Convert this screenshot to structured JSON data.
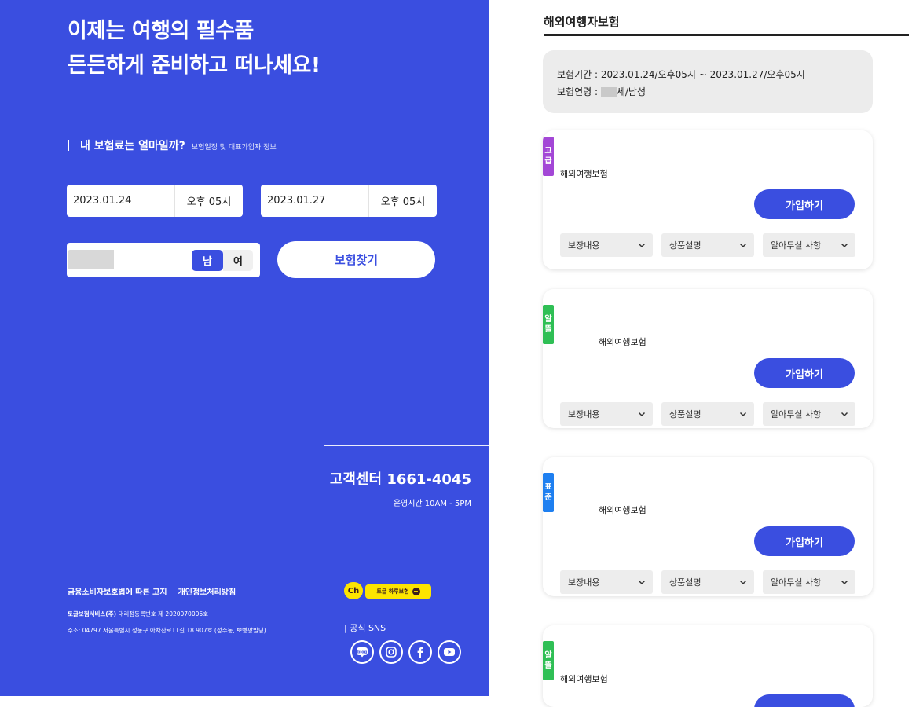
{
  "hero": {
    "line1": "이제는 여행의 필수품",
    "line2": "든든하게 준비하고 떠나세요!"
  },
  "query": {
    "title": "내 보험료는 얼마일까?",
    "subtitle": "보험일정 및 대표가입자 정보"
  },
  "dates": {
    "start_date": "2023.01.24",
    "start_time": "오후 05시",
    "end_date": "2023.01.27",
    "end_time": "오후 05시"
  },
  "gender": {
    "male": "남",
    "female": "여",
    "selected": "남"
  },
  "search_button": "보험찾기",
  "customer_center": {
    "title": "고객센터 1661-4045",
    "hours": "운영시간 10AM - 5PM"
  },
  "footer": {
    "link_1": "금융소비자보호법에 따른 고지",
    "link_2": "개인정보처리방침",
    "company_name": "토글보험서비스(주)",
    "company_reg": "대리점등록번호 제 2020070006호",
    "address": "주소: 04797 서울특별시 성동구 아차산로11길 18 907호 (성수동, 뽀빵팡빌딩)",
    "kakao_ch": "Ch",
    "kakao_channel": "토글 하루보험",
    "sns_label": "|  공식 SNS"
  },
  "colors": {
    "brand": "#3a4ee0",
    "kakao": "#fde500",
    "tag_premium": "#a347d6",
    "tag_value": "#2fbf55",
    "tag_standard": "#1e7ff0"
  },
  "results": {
    "section_title": "해외여행자보험",
    "period_label": "보험기간 : 2023.01.24/오후05시 ~ 2023.01.27/오후05시",
    "age_label_prefix": "보험연령 : ",
    "age_label_suffix": "세/남성",
    "cards": [
      {
        "tag_1": "고",
        "tag_2": "급",
        "product": "해외여행보험",
        "join": "가입하기",
        "coverage": "보장내용",
        "description": "상품설명",
        "notice": "알아두실 사항"
      },
      {
        "tag_1": "알",
        "tag_2": "뜰",
        "product": "해외여행보험",
        "join": "가입하기",
        "coverage": "보장내용",
        "description": "상품설명",
        "notice": "알아두실 사항"
      },
      {
        "tag_1": "표",
        "tag_2": "준",
        "product": "해외여행보험",
        "join": "가입하기",
        "coverage": "보장내용",
        "description": "상품설명",
        "notice": "알아두실 사항"
      },
      {
        "tag_1": "알",
        "tag_2": "뜰",
        "product": "해외여행보험"
      }
    ]
  }
}
